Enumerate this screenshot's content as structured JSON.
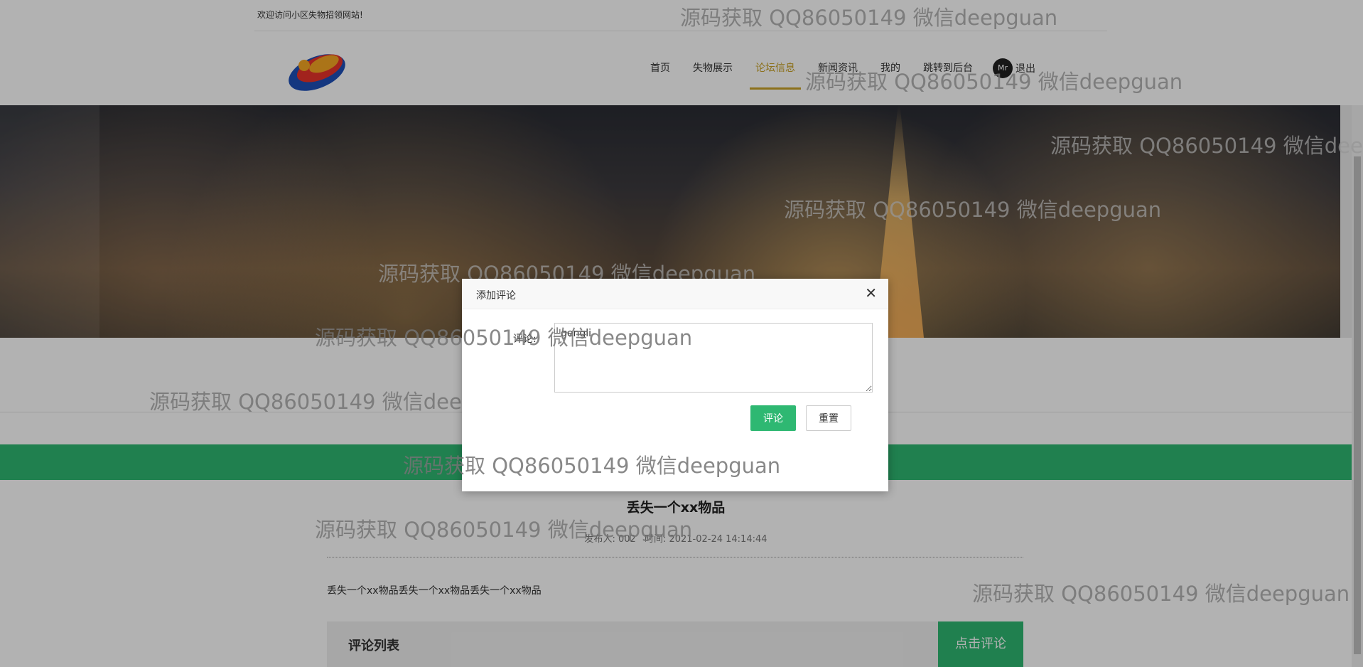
{
  "topbar": {
    "welcome": "欢迎访问小区失物招领网站!"
  },
  "nav": {
    "items": [
      {
        "label": "首页"
      },
      {
        "label": "失物展示"
      },
      {
        "label": "论坛信息",
        "active": true
      },
      {
        "label": "新闻资讯"
      },
      {
        "label": "我的"
      },
      {
        "label": "跳转到后台"
      }
    ],
    "avatar_text": "Mr",
    "logout_label": "退出"
  },
  "post": {
    "title": "丢失一个xx物品",
    "publisher_label": "发布人: 002",
    "time_label": "时间: 2021-02-24 14:14:44",
    "body": "丢失一个xx物品丢失一个xx物品丢失一个xx物品",
    "comment_list_title": "评论列表",
    "comment_button": "点击评论"
  },
  "modal": {
    "title": "添加评论",
    "close_icon": "close-icon",
    "label": "评论:",
    "value": "gengli",
    "submit_label": "评论",
    "reset_label": "重置"
  },
  "watermark": {
    "text": "源码获取 QQ86050149 微信deepguan"
  },
  "colors": {
    "accent_green": "#2eb872",
    "active_nav": "#c9a227"
  }
}
